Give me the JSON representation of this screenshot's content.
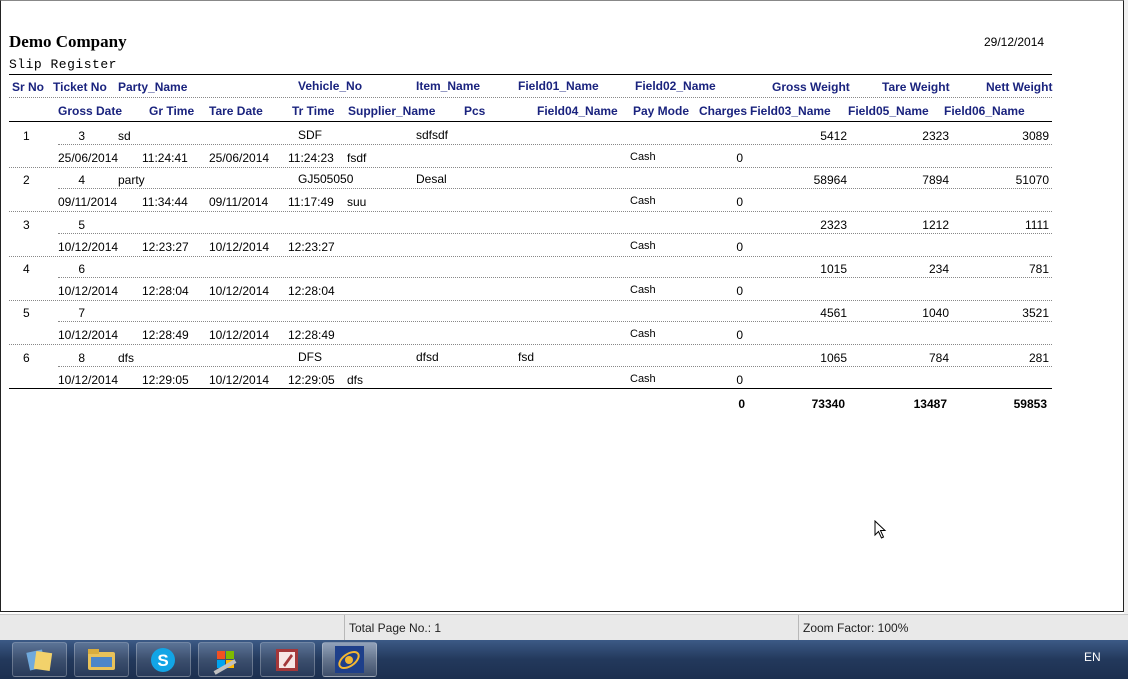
{
  "report": {
    "company": "Demo Company",
    "date": "29/12/2014",
    "subtitle": "Slip Register",
    "headers_row1": [
      "Sr No",
      "Ticket No",
      "Party_Name",
      "Vehicle_No",
      "Item_Name",
      "Field01_Name",
      "Field02_Name",
      "Gross Weight",
      "Tare Weight",
      "Nett Weight"
    ],
    "headers_row2": [
      "Gross Date",
      "Gr Time",
      "Tare Date",
      "Tr Time",
      "Supplier_Name",
      "Pcs",
      "Field04_Name",
      "Pay Mode",
      "Charges",
      "Field03_Name",
      "Field05_Name",
      "Field06_Name"
    ],
    "rows": [
      {
        "sr": "1",
        "ticket": "3",
        "party": "sd",
        "vehicle": "SDF",
        "item": "sdfsdf",
        "field01": "",
        "gross": "5412",
        "tare": "2323",
        "nett": "3089",
        "gross_date": "25/06/2014",
        "gr_time": "11:24:41",
        "tare_date": "25/06/2014",
        "tr_time": "11:24:23",
        "supplier": "fsdf",
        "pay_mode": "Cash",
        "charges": "0"
      },
      {
        "sr": "2",
        "ticket": "4",
        "party": "party",
        "vehicle": "GJ505050",
        "item": "Desal",
        "field01": "",
        "gross": "58964",
        "tare": "7894",
        "nett": "51070",
        "gross_date": "09/11/2014",
        "gr_time": "11:34:44",
        "tare_date": "09/11/2014",
        "tr_time": "11:17:49",
        "supplier": "suu",
        "pay_mode": "Cash",
        "charges": "0"
      },
      {
        "sr": "3",
        "ticket": "5",
        "party": "",
        "vehicle": "",
        "item": "",
        "field01": "",
        "gross": "2323",
        "tare": "1212",
        "nett": "1111",
        "gross_date": "10/12/2014",
        "gr_time": "12:23:27",
        "tare_date": "10/12/2014",
        "tr_time": "12:23:27",
        "supplier": "",
        "pay_mode": "Cash",
        "charges": "0"
      },
      {
        "sr": "4",
        "ticket": "6",
        "party": "",
        "vehicle": "",
        "item": "",
        "field01": "",
        "gross": "1015",
        "tare": "234",
        "nett": "781",
        "gross_date": "10/12/2014",
        "gr_time": "12:28:04",
        "tare_date": "10/12/2014",
        "tr_time": "12:28:04",
        "supplier": "",
        "pay_mode": "Cash",
        "charges": "0"
      },
      {
        "sr": "5",
        "ticket": "7",
        "party": "",
        "vehicle": "",
        "item": "",
        "field01": "",
        "gross": "4561",
        "tare": "1040",
        "nett": "3521",
        "gross_date": "10/12/2014",
        "gr_time": "12:28:49",
        "tare_date": "10/12/2014",
        "tr_time": "12:28:49",
        "supplier": "",
        "pay_mode": "Cash",
        "charges": "0"
      },
      {
        "sr": "6",
        "ticket": "8",
        "party": "dfs",
        "vehicle": "DFS",
        "item": "dfsd",
        "field01": "fsd",
        "gross": "1065",
        "tare": "784",
        "nett": "281",
        "gross_date": "10/12/2014",
        "gr_time": "12:29:05",
        "tare_date": "10/12/2014",
        "tr_time": "12:29:05",
        "supplier": "dfs",
        "pay_mode": "Cash",
        "charges": "0"
      }
    ],
    "totals": {
      "charges": "0",
      "gross": "73340",
      "tare": "13487",
      "nett": "59853"
    }
  },
  "statusbar": {
    "total_pages": "Total Page No.: 1",
    "zoom": "Zoom Factor: 100%"
  },
  "taskbar": {
    "buttons": [
      "library-icon",
      "explorer-icon",
      "skype-icon",
      "windows-tools-icon",
      "access-icon",
      "app-icon"
    ],
    "language": "EN"
  }
}
